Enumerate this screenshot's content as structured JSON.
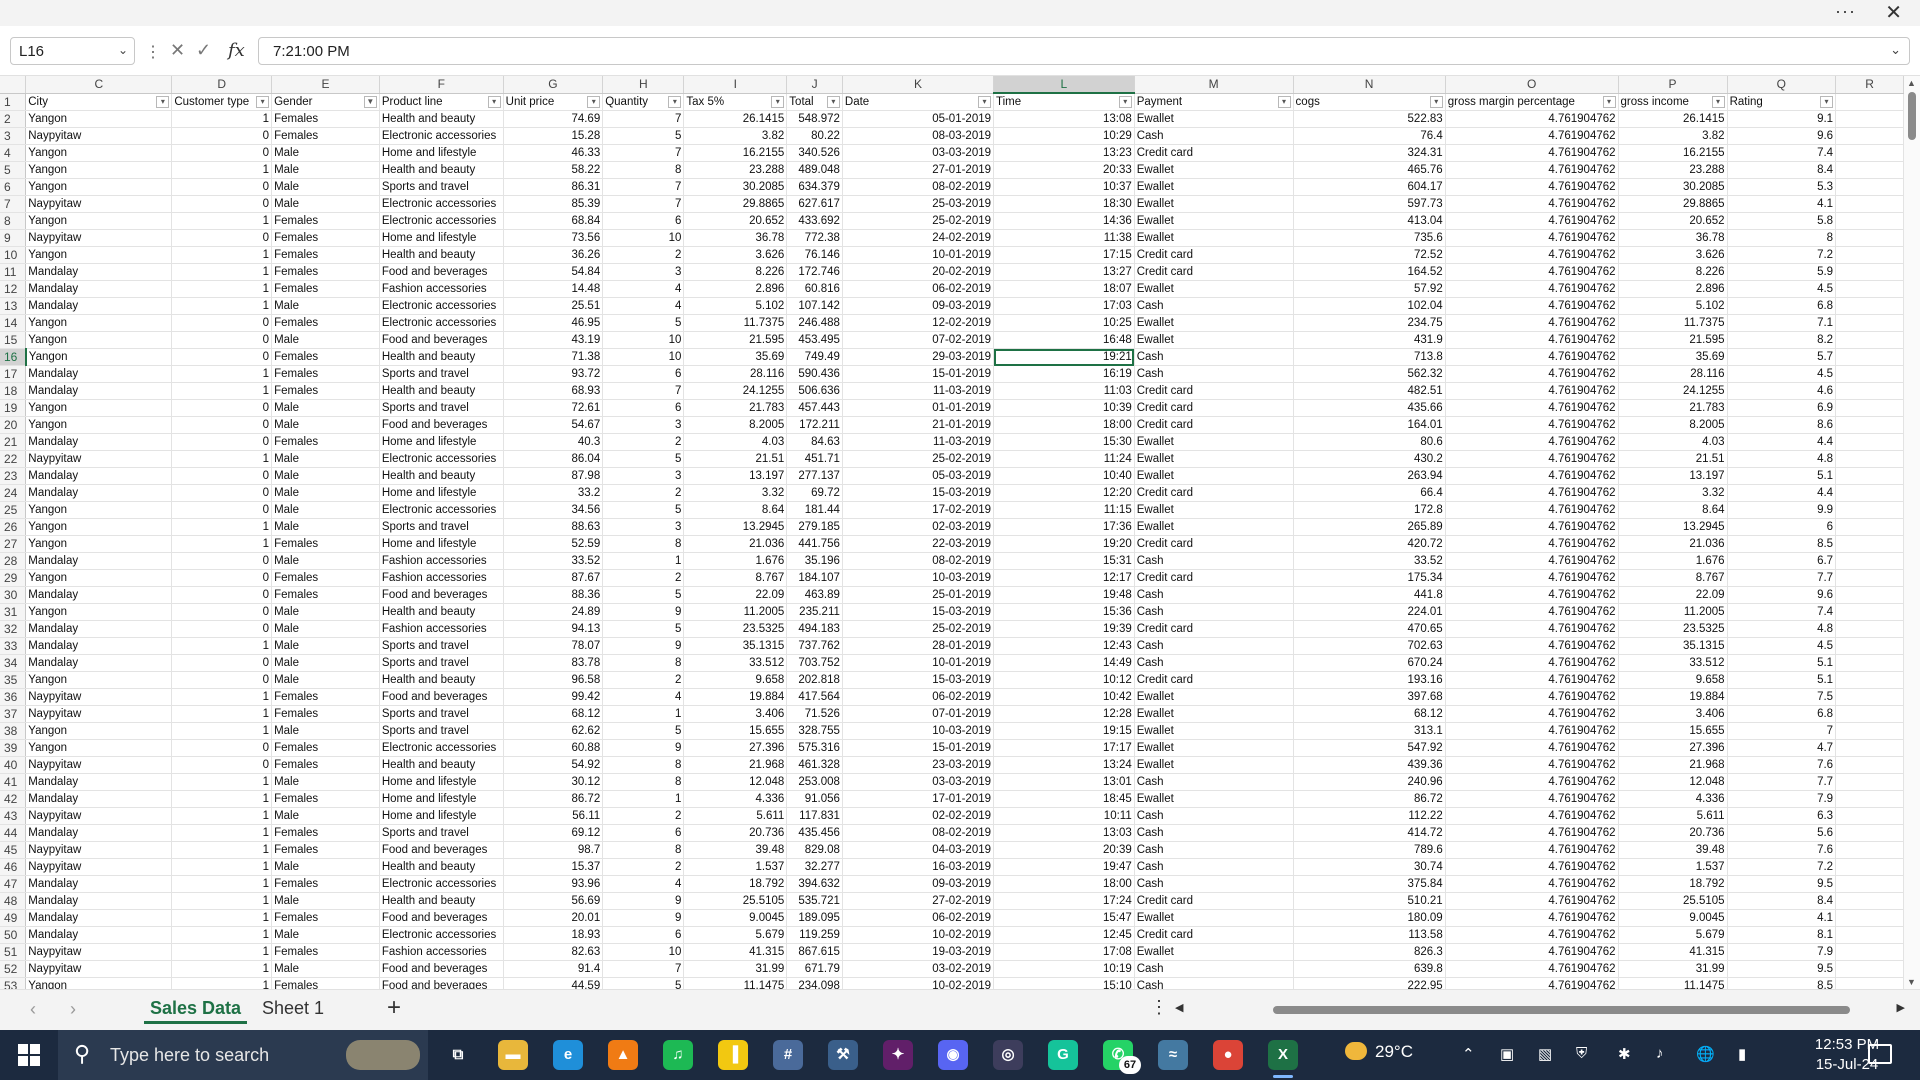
{
  "window": {
    "more_label": "···",
    "close_label": "✕"
  },
  "formula_bar": {
    "name_box": "L16",
    "cancel_symbol": "✕",
    "enter_symbol": "✓",
    "fx_symbol": "fx",
    "content": "7:21:00 PM"
  },
  "sheet": {
    "columns": [
      "C",
      "D",
      "E",
      "F",
      "G",
      "H",
      "I",
      "J",
      "K",
      "L",
      "M",
      "N",
      "O",
      "P",
      "Q",
      "R"
    ],
    "selected_column": "L",
    "selected_row": 16,
    "selected_cell": "L16",
    "headers": [
      "City",
      "Customer type",
      "Gender",
      "Product line",
      "Unit price",
      "Quantity",
      "Tax 5%",
      "Total",
      "Date",
      "Time",
      "Payment",
      "cogs",
      "gross margin percentage",
      "gross income",
      "Rating",
      ""
    ],
    "filter_active_column": "Gender",
    "rows": [
      [
        "Yangon",
        "1",
        "Females",
        "Health and beauty",
        "74.69",
        "7",
        "26.1415",
        "548.972",
        "05-01-2019",
        "13:08",
        "Ewallet",
        "522.83",
        "4.761904762",
        "26.1415",
        "9.1",
        ""
      ],
      [
        "Naypyitaw",
        "0",
        "Females",
        "Electronic accessories",
        "15.28",
        "5",
        "3.82",
        "80.22",
        "08-03-2019",
        "10:29",
        "Cash",
        "76.4",
        "4.761904762",
        "3.82",
        "9.6",
        ""
      ],
      [
        "Yangon",
        "0",
        "Male",
        "Home and lifestyle",
        "46.33",
        "7",
        "16.2155",
        "340.526",
        "03-03-2019",
        "13:23",
        "Credit card",
        "324.31",
        "4.761904762",
        "16.2155",
        "7.4",
        ""
      ],
      [
        "Yangon",
        "1",
        "Male",
        "Health and beauty",
        "58.22",
        "8",
        "23.288",
        "489.048",
        "27-01-2019",
        "20:33",
        "Ewallet",
        "465.76",
        "4.761904762",
        "23.288",
        "8.4",
        ""
      ],
      [
        "Yangon",
        "0",
        "Male",
        "Sports and travel",
        "86.31",
        "7",
        "30.2085",
        "634.379",
        "08-02-2019",
        "10:37",
        "Ewallet",
        "604.17",
        "4.761904762",
        "30.2085",
        "5.3",
        ""
      ],
      [
        "Naypyitaw",
        "0",
        "Male",
        "Electronic accessories",
        "85.39",
        "7",
        "29.8865",
        "627.617",
        "25-03-2019",
        "18:30",
        "Ewallet",
        "597.73",
        "4.761904762",
        "29.8865",
        "4.1",
        ""
      ],
      [
        "Yangon",
        "1",
        "Females",
        "Electronic accessories",
        "68.84",
        "6",
        "20.652",
        "433.692",
        "25-02-2019",
        "14:36",
        "Ewallet",
        "413.04",
        "4.761904762",
        "20.652",
        "5.8",
        ""
      ],
      [
        "Naypyitaw",
        "0",
        "Females",
        "Home and lifestyle",
        "73.56",
        "10",
        "36.78",
        "772.38",
        "24-02-2019",
        "11:38",
        "Ewallet",
        "735.6",
        "4.761904762",
        "36.78",
        "8",
        ""
      ],
      [
        "Yangon",
        "1",
        "Females",
        "Health and beauty",
        "36.26",
        "2",
        "3.626",
        "76.146",
        "10-01-2019",
        "17:15",
        "Credit card",
        "72.52",
        "4.761904762",
        "3.626",
        "7.2",
        ""
      ],
      [
        "Mandalay",
        "1",
        "Females",
        "Food and beverages",
        "54.84",
        "3",
        "8.226",
        "172.746",
        "20-02-2019",
        "13:27",
        "Credit card",
        "164.52",
        "4.761904762",
        "8.226",
        "5.9",
        ""
      ],
      [
        "Mandalay",
        "1",
        "Females",
        "Fashion accessories",
        "14.48",
        "4",
        "2.896",
        "60.816",
        "06-02-2019",
        "18:07",
        "Ewallet",
        "57.92",
        "4.761904762",
        "2.896",
        "4.5",
        ""
      ],
      [
        "Mandalay",
        "1",
        "Male",
        "Electronic accessories",
        "25.51",
        "4",
        "5.102",
        "107.142",
        "09-03-2019",
        "17:03",
        "Cash",
        "102.04",
        "4.761904762",
        "5.102",
        "6.8",
        ""
      ],
      [
        "Yangon",
        "0",
        "Females",
        "Electronic accessories",
        "46.95",
        "5",
        "11.7375",
        "246.488",
        "12-02-2019",
        "10:25",
        "Ewallet",
        "234.75",
        "4.761904762",
        "11.7375",
        "7.1",
        ""
      ],
      [
        "Yangon",
        "0",
        "Male",
        "Food and beverages",
        "43.19",
        "10",
        "21.595",
        "453.495",
        "07-02-2019",
        "16:48",
        "Ewallet",
        "431.9",
        "4.761904762",
        "21.595",
        "8.2",
        ""
      ],
      [
        "Yangon",
        "0",
        "Females",
        "Health and beauty",
        "71.38",
        "10",
        "35.69",
        "749.49",
        "29-03-2019",
        "19:21",
        "Cash",
        "713.8",
        "4.761904762",
        "35.69",
        "5.7",
        ""
      ],
      [
        "Mandalay",
        "1",
        "Females",
        "Sports and travel",
        "93.72",
        "6",
        "28.116",
        "590.436",
        "15-01-2019",
        "16:19",
        "Cash",
        "562.32",
        "4.761904762",
        "28.116",
        "4.5",
        ""
      ],
      [
        "Mandalay",
        "1",
        "Females",
        "Health and beauty",
        "68.93",
        "7",
        "24.1255",
        "506.636",
        "11-03-2019",
        "11:03",
        "Credit card",
        "482.51",
        "4.761904762",
        "24.1255",
        "4.6",
        ""
      ],
      [
        "Yangon",
        "0",
        "Male",
        "Sports and travel",
        "72.61",
        "6",
        "21.783",
        "457.443",
        "01-01-2019",
        "10:39",
        "Credit card",
        "435.66",
        "4.761904762",
        "21.783",
        "6.9",
        ""
      ],
      [
        "Yangon",
        "0",
        "Male",
        "Food and beverages",
        "54.67",
        "3",
        "8.2005",
        "172.211",
        "21-01-2019",
        "18:00",
        "Credit card",
        "164.01",
        "4.761904762",
        "8.2005",
        "8.6",
        ""
      ],
      [
        "Mandalay",
        "0",
        "Females",
        "Home and lifestyle",
        "40.3",
        "2",
        "4.03",
        "84.63",
        "11-03-2019",
        "15:30",
        "Ewallet",
        "80.6",
        "4.761904762",
        "4.03",
        "4.4",
        ""
      ],
      [
        "Naypyitaw",
        "1",
        "Male",
        "Electronic accessories",
        "86.04",
        "5",
        "21.51",
        "451.71",
        "25-02-2019",
        "11:24",
        "Ewallet",
        "430.2",
        "4.761904762",
        "21.51",
        "4.8",
        ""
      ],
      [
        "Mandalay",
        "0",
        "Male",
        "Health and beauty",
        "87.98",
        "3",
        "13.197",
        "277.137",
        "05-03-2019",
        "10:40",
        "Ewallet",
        "263.94",
        "4.761904762",
        "13.197",
        "5.1",
        ""
      ],
      [
        "Mandalay",
        "0",
        "Male",
        "Home and lifestyle",
        "33.2",
        "2",
        "3.32",
        "69.72",
        "15-03-2019",
        "12:20",
        "Credit card",
        "66.4",
        "4.761904762",
        "3.32",
        "4.4",
        ""
      ],
      [
        "Yangon",
        "0",
        "Male",
        "Electronic accessories",
        "34.56",
        "5",
        "8.64",
        "181.44",
        "17-02-2019",
        "11:15",
        "Ewallet",
        "172.8",
        "4.761904762",
        "8.64",
        "9.9",
        ""
      ],
      [
        "Yangon",
        "1",
        "Male",
        "Sports and travel",
        "88.63",
        "3",
        "13.2945",
        "279.185",
        "02-03-2019",
        "17:36",
        "Ewallet",
        "265.89",
        "4.761904762",
        "13.2945",
        "6",
        ""
      ],
      [
        "Yangon",
        "1",
        "Females",
        "Home and lifestyle",
        "52.59",
        "8",
        "21.036",
        "441.756",
        "22-03-2019",
        "19:20",
        "Credit card",
        "420.72",
        "4.761904762",
        "21.036",
        "8.5",
        ""
      ],
      [
        "Mandalay",
        "0",
        "Male",
        "Fashion accessories",
        "33.52",
        "1",
        "1.676",
        "35.196",
        "08-02-2019",
        "15:31",
        "Cash",
        "33.52",
        "4.761904762",
        "1.676",
        "6.7",
        ""
      ],
      [
        "Yangon",
        "0",
        "Females",
        "Fashion accessories",
        "87.67",
        "2",
        "8.767",
        "184.107",
        "10-03-2019",
        "12:17",
        "Credit card",
        "175.34",
        "4.761904762",
        "8.767",
        "7.7",
        ""
      ],
      [
        "Mandalay",
        "0",
        "Females",
        "Food and beverages",
        "88.36",
        "5",
        "22.09",
        "463.89",
        "25-01-2019",
        "19:48",
        "Cash",
        "441.8",
        "4.761904762",
        "22.09",
        "9.6",
        ""
      ],
      [
        "Yangon",
        "0",
        "Male",
        "Health and beauty",
        "24.89",
        "9",
        "11.2005",
        "235.211",
        "15-03-2019",
        "15:36",
        "Cash",
        "224.01",
        "4.761904762",
        "11.2005",
        "7.4",
        ""
      ],
      [
        "Mandalay",
        "0",
        "Male",
        "Fashion accessories",
        "94.13",
        "5",
        "23.5325",
        "494.183",
        "25-02-2019",
        "19:39",
        "Credit card",
        "470.65",
        "4.761904762",
        "23.5325",
        "4.8",
        ""
      ],
      [
        "Mandalay",
        "1",
        "Male",
        "Sports and travel",
        "78.07",
        "9",
        "35.1315",
        "737.762",
        "28-01-2019",
        "12:43",
        "Cash",
        "702.63",
        "4.761904762",
        "35.1315",
        "4.5",
        ""
      ],
      [
        "Mandalay",
        "0",
        "Male",
        "Sports and travel",
        "83.78",
        "8",
        "33.512",
        "703.752",
        "10-01-2019",
        "14:49",
        "Cash",
        "670.24",
        "4.761904762",
        "33.512",
        "5.1",
        ""
      ],
      [
        "Yangon",
        "0",
        "Male",
        "Health and beauty",
        "96.58",
        "2",
        "9.658",
        "202.818",
        "15-03-2019",
        "10:12",
        "Credit card",
        "193.16",
        "4.761904762",
        "9.658",
        "5.1",
        ""
      ],
      [
        "Naypyitaw",
        "1",
        "Females",
        "Food and beverages",
        "99.42",
        "4",
        "19.884",
        "417.564",
        "06-02-2019",
        "10:42",
        "Ewallet",
        "397.68",
        "4.761904762",
        "19.884",
        "7.5",
        ""
      ],
      [
        "Naypyitaw",
        "1",
        "Females",
        "Sports and travel",
        "68.12",
        "1",
        "3.406",
        "71.526",
        "07-01-2019",
        "12:28",
        "Ewallet",
        "68.12",
        "4.761904762",
        "3.406",
        "6.8",
        ""
      ],
      [
        "Yangon",
        "1",
        "Male",
        "Sports and travel",
        "62.62",
        "5",
        "15.655",
        "328.755",
        "10-03-2019",
        "19:15",
        "Ewallet",
        "313.1",
        "4.761904762",
        "15.655",
        "7",
        ""
      ],
      [
        "Yangon",
        "0",
        "Females",
        "Electronic accessories",
        "60.88",
        "9",
        "27.396",
        "575.316",
        "15-01-2019",
        "17:17",
        "Ewallet",
        "547.92",
        "4.761904762",
        "27.396",
        "4.7",
        ""
      ],
      [
        "Naypyitaw",
        "0",
        "Females",
        "Health and beauty",
        "54.92",
        "8",
        "21.968",
        "461.328",
        "23-03-2019",
        "13:24",
        "Ewallet",
        "439.36",
        "4.761904762",
        "21.968",
        "7.6",
        ""
      ],
      [
        "Mandalay",
        "1",
        "Male",
        "Home and lifestyle",
        "30.12",
        "8",
        "12.048",
        "253.008",
        "03-03-2019",
        "13:01",
        "Cash",
        "240.96",
        "4.761904762",
        "12.048",
        "7.7",
        ""
      ],
      [
        "Mandalay",
        "1",
        "Females",
        "Home and lifestyle",
        "86.72",
        "1",
        "4.336",
        "91.056",
        "17-01-2019",
        "18:45",
        "Ewallet",
        "86.72",
        "4.761904762",
        "4.336",
        "7.9",
        ""
      ],
      [
        "Naypyitaw",
        "1",
        "Male",
        "Home and lifestyle",
        "56.11",
        "2",
        "5.611",
        "117.831",
        "02-02-2019",
        "10:11",
        "Cash",
        "112.22",
        "4.761904762",
        "5.611",
        "6.3",
        ""
      ],
      [
        "Mandalay",
        "1",
        "Females",
        "Sports and travel",
        "69.12",
        "6",
        "20.736",
        "435.456",
        "08-02-2019",
        "13:03",
        "Cash",
        "414.72",
        "4.761904762",
        "20.736",
        "5.6",
        ""
      ],
      [
        "Naypyitaw",
        "1",
        "Females",
        "Food and beverages",
        "98.7",
        "8",
        "39.48",
        "829.08",
        "04-03-2019",
        "20:39",
        "Cash",
        "789.6",
        "4.761904762",
        "39.48",
        "7.6",
        ""
      ],
      [
        "Naypyitaw",
        "1",
        "Male",
        "Health and beauty",
        "15.37",
        "2",
        "1.537",
        "32.277",
        "16-03-2019",
        "19:47",
        "Cash",
        "30.74",
        "4.761904762",
        "1.537",
        "7.2",
        ""
      ],
      [
        "Mandalay",
        "1",
        "Females",
        "Electronic accessories",
        "93.96",
        "4",
        "18.792",
        "394.632",
        "09-03-2019",
        "18:00",
        "Cash",
        "375.84",
        "4.761904762",
        "18.792",
        "9.5",
        ""
      ],
      [
        "Mandalay",
        "1",
        "Male",
        "Health and beauty",
        "56.69",
        "9",
        "25.5105",
        "535.721",
        "27-02-2019",
        "17:24",
        "Credit card",
        "510.21",
        "4.761904762",
        "25.5105",
        "8.4",
        ""
      ],
      [
        "Mandalay",
        "1",
        "Females",
        "Food and beverages",
        "20.01",
        "9",
        "9.0045",
        "189.095",
        "06-02-2019",
        "15:47",
        "Ewallet",
        "180.09",
        "4.761904762",
        "9.0045",
        "4.1",
        ""
      ],
      [
        "Mandalay",
        "1",
        "Male",
        "Electronic accessories",
        "18.93",
        "6",
        "5.679",
        "119.259",
        "10-02-2019",
        "12:45",
        "Credit card",
        "113.58",
        "4.761904762",
        "5.679",
        "8.1",
        ""
      ],
      [
        "Naypyitaw",
        "1",
        "Females",
        "Fashion accessories",
        "82.63",
        "10",
        "41.315",
        "867.615",
        "19-03-2019",
        "17:08",
        "Ewallet",
        "826.3",
        "4.761904762",
        "41.315",
        "7.9",
        ""
      ],
      [
        "Naypyitaw",
        "1",
        "Male",
        "Food and beverages",
        "91.4",
        "7",
        "31.99",
        "671.79",
        "03-02-2019",
        "10:19",
        "Cash",
        "639.8",
        "4.761904762",
        "31.99",
        "9.5",
        ""
      ],
      [
        "Yangon",
        "1",
        "Females",
        "Food and beverages",
        "44.59",
        "5",
        "11.1475",
        "234.098",
        "10-02-2019",
        "15:10",
        "Cash",
        "222.95",
        "4.761904762",
        "11.1475",
        "8.5",
        ""
      ]
    ]
  },
  "tabs": {
    "items": [
      "Sales Data",
      "Sheet 1"
    ],
    "active": "Sales Data",
    "add_label": "+",
    "more_label": "⋮"
  },
  "taskbar": {
    "search_placeholder": "Type here to search",
    "whatsapp_badge": "67",
    "weather": "29°C",
    "time": "12:53 PM",
    "date": "15-Jul-24",
    "apps": [
      {
        "name": "task-view",
        "glyph": "⧉",
        "color": "#1c2a3f"
      },
      {
        "name": "file-explorer",
        "glyph": "▬",
        "color": "#e8b73b"
      },
      {
        "name": "edge",
        "glyph": "e",
        "color": "#1f8fd9"
      },
      {
        "name": "vlc",
        "glyph": "▲",
        "color": "#f07b14"
      },
      {
        "name": "spotify",
        "glyph": "♫",
        "color": "#1db954"
      },
      {
        "name": "power-bi",
        "glyph": "▐",
        "color": "#f2c811"
      },
      {
        "name": "calculator",
        "glyph": "#",
        "color": "#4a6a9a"
      },
      {
        "name": "sql-studio",
        "glyph": "⚒",
        "color": "#3a5f8a"
      },
      {
        "name": "slack",
        "glyph": "✦",
        "color": "#611f69"
      },
      {
        "name": "discord",
        "glyph": "◉",
        "color": "#5865f2"
      },
      {
        "name": "obs",
        "glyph": "◎",
        "color": "#3d3d5c"
      },
      {
        "name": "grammarly",
        "glyph": "G",
        "color": "#15c39a"
      },
      {
        "name": "whatsapp",
        "glyph": "✆",
        "color": "#25d366"
      },
      {
        "name": "mysql",
        "glyph": "≈",
        "color": "#4479a1"
      },
      {
        "name": "chrome",
        "glyph": "●",
        "color": "#db4437"
      },
      {
        "name": "excel",
        "glyph": "X",
        "color": "#1e7145"
      }
    ],
    "active_app": "excel"
  }
}
